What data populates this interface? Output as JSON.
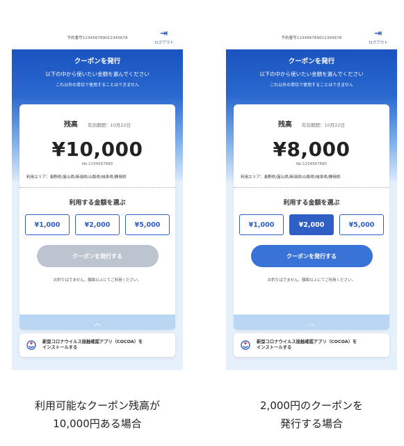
{
  "screens": [
    {
      "reservation_no": "予約番号1234567890123456​78",
      "logout_label": "ログアウト",
      "header_title": "クーポンを発行",
      "header_line1": "以下の中から使いたい金額を選んでください",
      "header_line2": "これ以外の単位で使用することはできません",
      "balance_label": "残高",
      "expiry": "有効期間：10月22日",
      "balance_amount": "¥10,000",
      "card_no": "No.1234567890",
      "area_text": "利用エリア：長野県/富山県/新潟県/山梨県/岐阜県/静岡県",
      "choose_label": "利用する金額を選ぶ",
      "amounts": [
        "¥1,000",
        "¥2,000",
        "¥5,000"
      ],
      "selected_index": -1,
      "issue_label": "クーポンを発行する",
      "issue_enabled": false,
      "note": "お釣りはでません。額面以上にてご利用ください。",
      "cocoa_line1": "新型コロナウイルス接触確認アプリ（COCOA）を",
      "cocoa_line2": "インストールする",
      "caption_line1": "利用可能なクーポン残高が",
      "caption_line2": "10,000円ある場合"
    },
    {
      "reservation_no": "予約番号1234567890123456​78",
      "logout_label": "ログアウト",
      "header_title": "クーポンを発行",
      "header_line1": "以下の中から使いたい金額を選んでください",
      "header_line2": "これ以外の単位で使用することはできません",
      "balance_label": "残高",
      "expiry": "有効期間：10月22日",
      "balance_amount": "¥8,000",
      "card_no": "No.1234567890",
      "area_text": "利用エリア：長野県/富山県/新潟県/山梨県/岐阜県/静岡県",
      "choose_label": "利用する金額を選ぶ",
      "amounts": [
        "¥1,000",
        "¥2,000",
        "¥5,000"
      ],
      "selected_index": 1,
      "issue_label": "クーポンを発行する",
      "issue_enabled": true,
      "note": "お釣りはでません。額面以上にてご利用ください。",
      "cocoa_line1": "新型コロナウイルス接触確認アプリ（COCOA）を",
      "cocoa_line2": "インストールする",
      "caption_line1": "2,000円のクーポンを",
      "caption_line2": "発行する場合"
    }
  ],
  "colors": {
    "primary": "#2f5ec4",
    "button_active": "#3a73d8",
    "button_disabled": "#bcc5cf",
    "header_blue": "#1a53c0"
  },
  "icons": {
    "logout": "logout-arrow-icon",
    "collapse": "chevron-up-icon",
    "cocoa": "cocoa-app-icon"
  }
}
